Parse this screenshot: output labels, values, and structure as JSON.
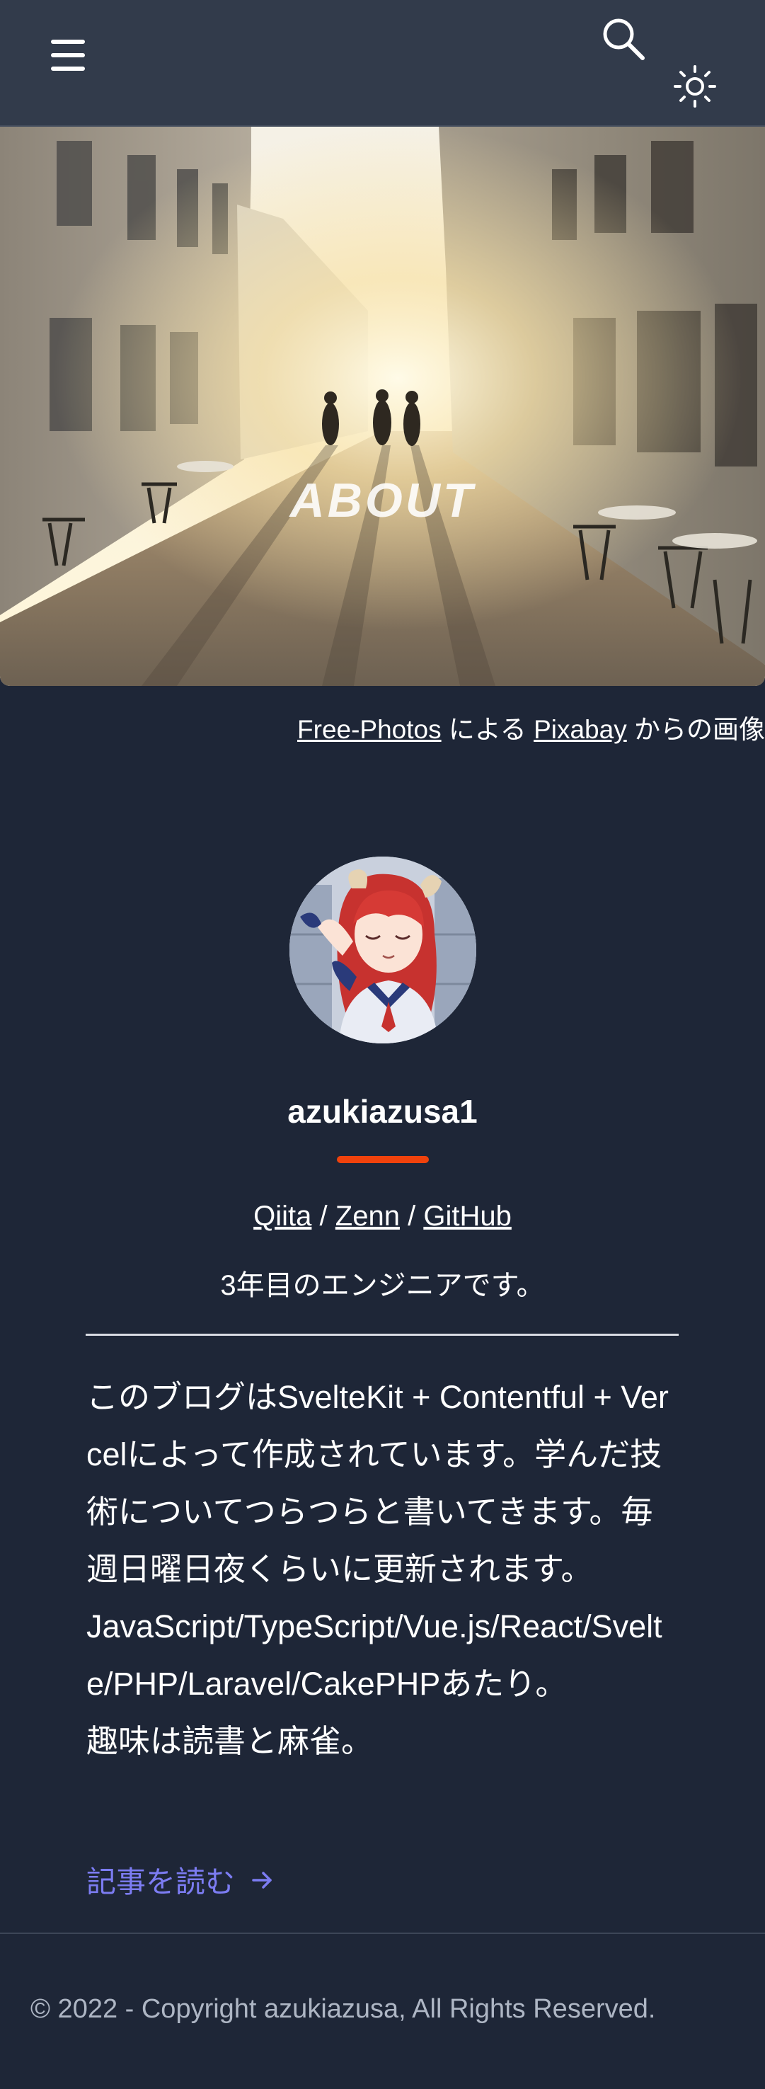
{
  "header": {
    "menu_icon": "hamburger-menu-icon",
    "search_icon": "search-icon",
    "theme_icon": "sun-icon"
  },
  "hero": {
    "title": "ABOUT"
  },
  "credit": {
    "author_link": "Free-Photos",
    "by_text": "による",
    "site_link": "Pixabay",
    "suffix_text": "からの画像"
  },
  "profile": {
    "username": "azukiazusa1",
    "accent_color": "#f0420c",
    "links": [
      {
        "label": "Qiita"
      },
      {
        "label": "Zenn"
      },
      {
        "label": "GitHub"
      }
    ],
    "link_separator": "/",
    "short_bio": "3年目のエンジニアです。",
    "long_bio": [
      "このブログはSvelteKit + Contentful + Vercelによって作成されています。学んだ技術についてつらつらと書いてきます。毎週日曜日夜くらいに更新されます。",
      "JavaScript/TypeScript/Vue.js/React/Svelte/PHP/Laravel/CakePHPあたり。",
      "趣味は読書と麻雀。"
    ],
    "read_link": "記事を読む",
    "read_link_color": "#7c7cf2"
  },
  "footer": {
    "copyright": "© 2022 - Copyright azukiazusa, All Rights Reserved."
  }
}
